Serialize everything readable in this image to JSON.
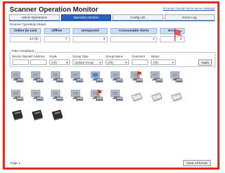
{
  "window": {
    "title": "Scanner Operation Monitor",
    "help_link": "[Scanner Central Admin Server Settings]"
  },
  "tabs": [
    {
      "label": "Admin Operations",
      "active": false
    },
    {
      "label": "Operation Monitor",
      "active": true
    },
    {
      "label": "Config List",
      "active": false
    },
    {
      "label": "Event Log",
      "active": false
    }
  ],
  "status": {
    "section_label": "Scanner Operating Status",
    "cells": [
      {
        "label": "Online (In use)",
        "value": "12 (0)"
      },
      {
        "label": "Offline",
        "value": "7"
      },
      {
        "label": "Unreported",
        "value": "2"
      },
      {
        "label": "Consumable Alerts",
        "value": "4"
      },
      {
        "label": "Error",
        "value": "2"
      }
    ],
    "error_color": "#e84040"
  },
  "filter": {
    "legend": "Filter Conditions",
    "device_name": {
      "label": "Device Name",
      "value": ""
    },
    "ip_address": {
      "label": "IP Address",
      "value": ""
    },
    "scale": {
      "label": "Scale",
      "value": "(All)"
    },
    "group_type": {
      "label": "Group Type",
      "value": "Update Group"
    },
    "group_name": {
      "label": "Group Name",
      "value": "(All)"
    },
    "comment": {
      "label": "Comment",
      "value": ""
    },
    "status": {
      "label": "Status",
      "value": "(All)"
    },
    "apply_label": "Apply"
  },
  "devices": [
    {
      "icon": "scanner-pc-icon",
      "state": "normal"
    },
    {
      "icon": "scanner-pc-icon",
      "state": "normal"
    },
    {
      "icon": "scanner-pc-icon",
      "state": "normal"
    },
    {
      "icon": "scanner-pc-icon",
      "state": "normal"
    },
    {
      "icon": "scanner-pc-icon",
      "state": "active"
    },
    {
      "icon": "scanner-pc-icon",
      "state": "normal"
    },
    {
      "icon": "scanner-pc-icon",
      "state": "error"
    },
    {
      "icon": "scanner-pc-icon",
      "state": "normal"
    },
    {
      "icon": "scanner-pc-icon",
      "state": "normal"
    },
    {
      "icon": "scanner-pc-icon",
      "state": "normal"
    },
    {
      "icon": "scanner-pc-icon",
      "state": "normal"
    },
    {
      "icon": "scanner-pc-icon",
      "state": "normal"
    },
    {
      "icon": "scanner-pc-icon",
      "state": "normal"
    },
    {
      "icon": "scanner-pc-icon",
      "state": "error"
    },
    {
      "icon": "scanner-pc-icon",
      "state": "normal"
    },
    {
      "icon": "desktop-scanner-icon",
      "state": "normal"
    },
    {
      "icon": "desktop-scanner-icon",
      "state": "normal"
    },
    {
      "icon": "desktop-scanner-icon",
      "state": "normal"
    },
    {
      "icon": "black-scanner-icon",
      "state": "normal"
    },
    {
      "icon": "black-scanner-icon",
      "state": "normal"
    },
    {
      "icon": "black-scanner-icon",
      "state": "normal"
    }
  ],
  "footer": {
    "page_label": "Page 1",
    "clear_button": "Clear All Errors"
  }
}
